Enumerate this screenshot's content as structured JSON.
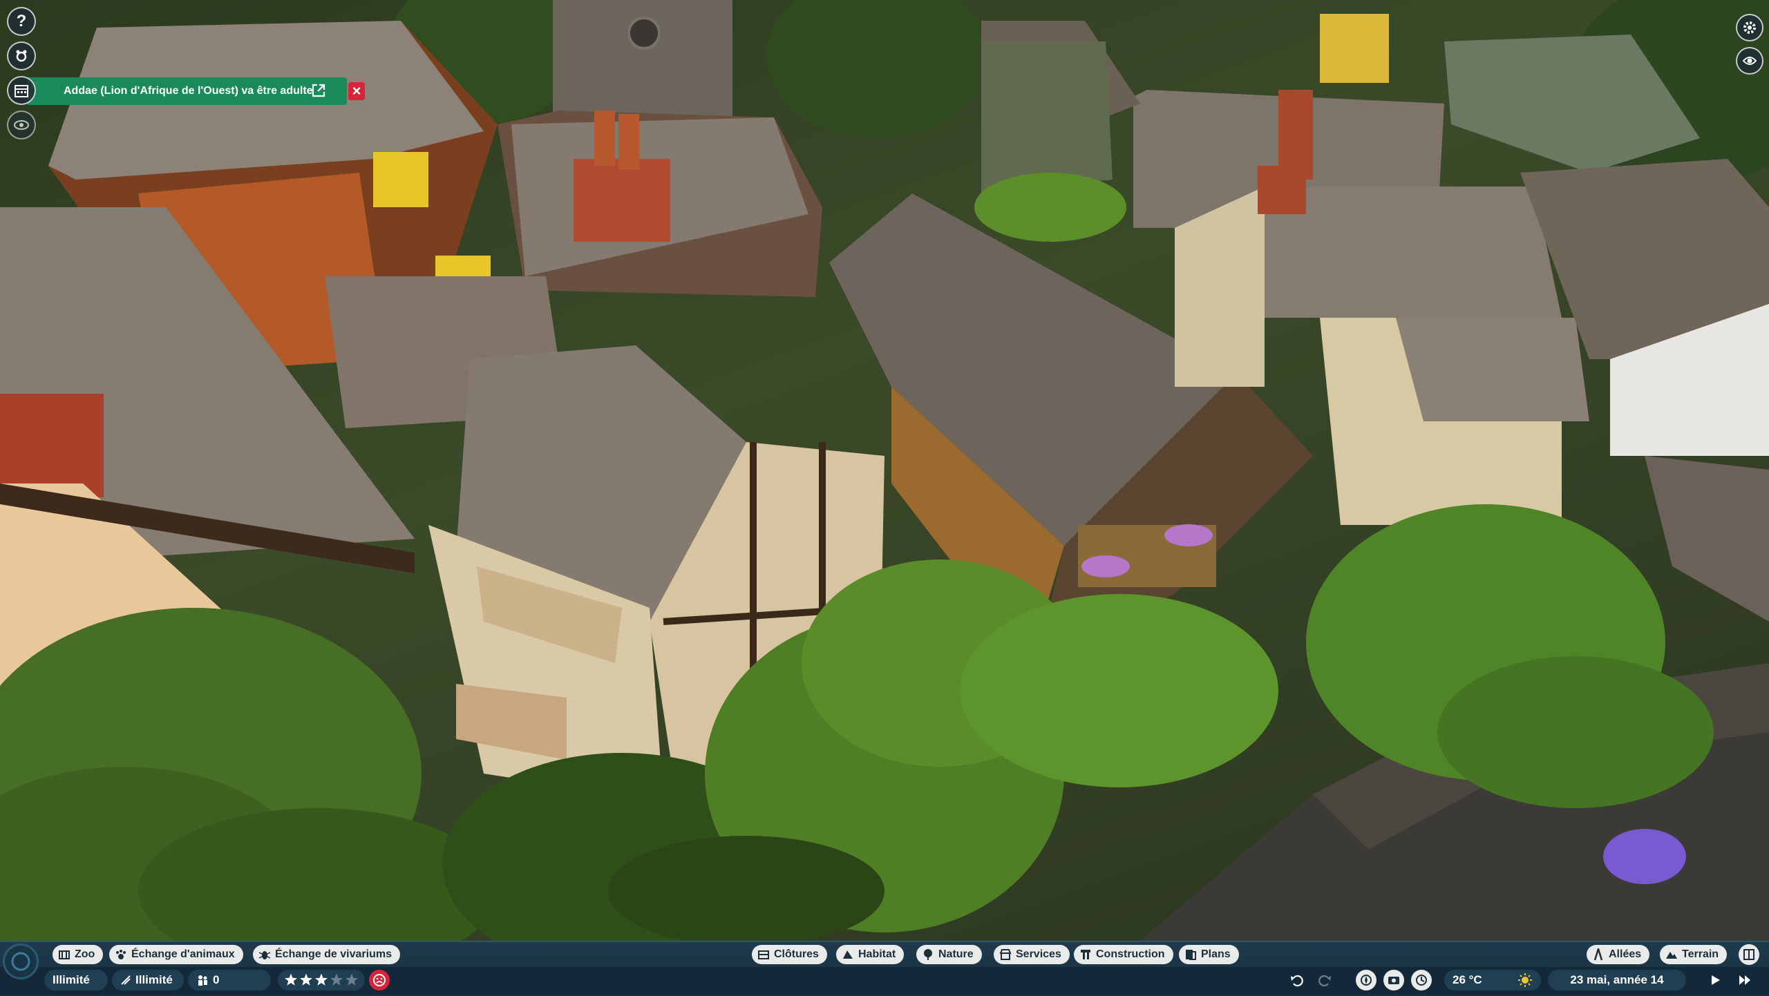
{
  "notification": {
    "text": "Addae (Lion d'Afrique de l'Ouest) va être adulte",
    "close_symbol": "×"
  },
  "left_tools": [
    {
      "icon": "help-icon",
      "glyph": "?"
    },
    {
      "icon": "animal-icon",
      "glyph": ""
    },
    {
      "icon": "calendar-icon",
      "glyph": ""
    },
    {
      "icon": "eye-icon",
      "glyph": ""
    }
  ],
  "bottom_left_tabs": [
    {
      "label": "Zoo",
      "icon": "zoo-icon"
    },
    {
      "label": "Échange d'animaux",
      "icon": "paw-icon"
    },
    {
      "label": "Échange de vivariums",
      "icon": "bug-icon"
    }
  ],
  "bottom_center_tabs": [
    {
      "label": "Clôtures",
      "icon": "fence-icon"
    },
    {
      "label": "Habitat",
      "icon": "habitat-icon"
    },
    {
      "label": "Nature",
      "icon": "tree-icon"
    },
    {
      "label": "Services",
      "icon": "shop-icon"
    },
    {
      "label": "Construction",
      "icon": "construction-icon"
    },
    {
      "label": "Plans",
      "icon": "blueprint-icon"
    }
  ],
  "bottom_right_tabs": [
    {
      "label": "Allées",
      "icon": "path-icon"
    },
    {
      "label": "Terrain",
      "icon": "terrain-icon"
    }
  ],
  "stats": {
    "money": "Illimité",
    "research": "Illimité",
    "guests": "0",
    "rating_stars": 3,
    "rating_max": 5
  },
  "weather": {
    "temperature": "26 °C",
    "date": "23 mai, année 14"
  },
  "colors": {
    "notification_bg": "#1a8a5a",
    "close_red": "#d8233a",
    "bar_bg": "#1f3a4c",
    "pill_bg": "#e8ebe9",
    "star_gold": "#f2c230"
  }
}
